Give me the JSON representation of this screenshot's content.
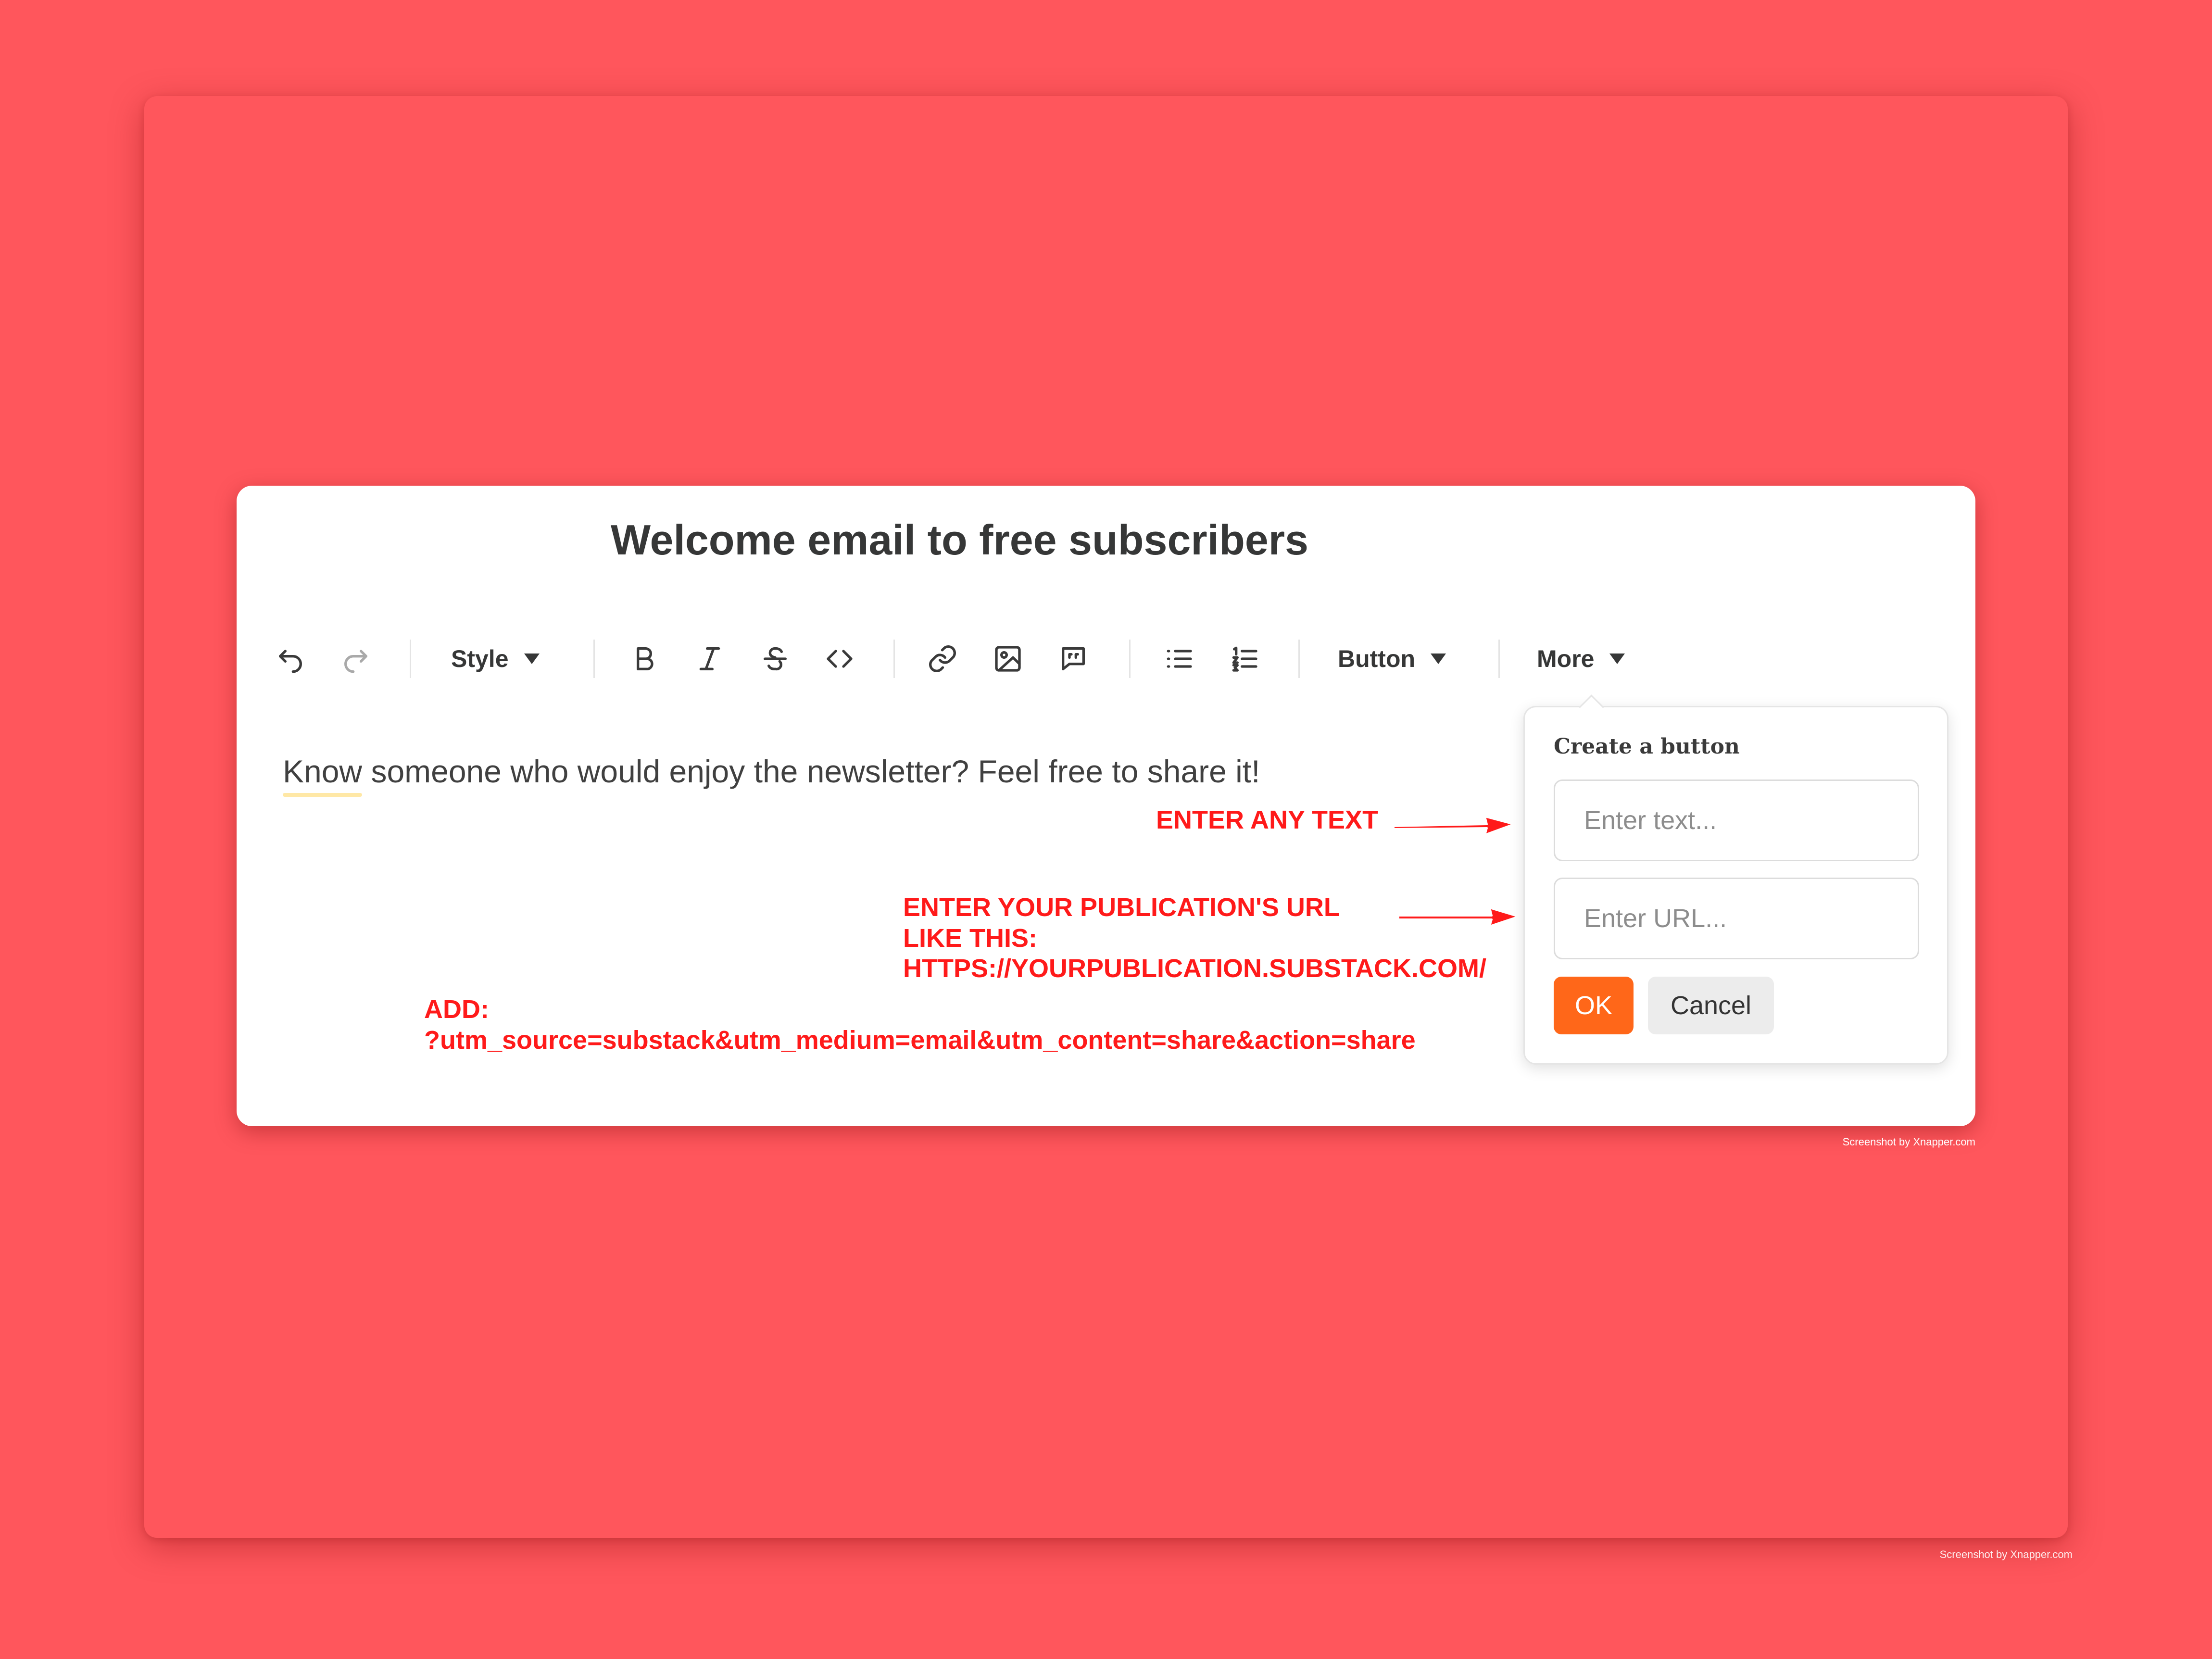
{
  "editor": {
    "title": "Welcome email to free subscribers",
    "body_first_word": "Know",
    "body_rest": " someone who would enjoy the newsletter? Feel free to share it!"
  },
  "toolbar": {
    "style_label": "Style",
    "button_label": "Button",
    "more_label": "More",
    "icons": [
      "undo-icon",
      "redo-icon",
      "bold-icon",
      "italic-icon",
      "strikethrough-icon",
      "code-icon",
      "link-icon",
      "image-icon",
      "quote-icon",
      "bullet-list-icon",
      "numbered-list-icon"
    ]
  },
  "popover": {
    "title": "Create a button",
    "text_placeholder": "Enter text...",
    "url_placeholder": "Enter URL...",
    "ok_label": "OK",
    "cancel_label": "Cancel"
  },
  "annotations": {
    "enter_text": "ENTER ANY TEXT",
    "url_line1": "ENTER YOUR PUBLICATION'S URL",
    "url_line2": "LIKE THIS:",
    "url_line3": "HTTPS://YOURPUBLICATION.SUBSTACK.COM/",
    "add_line1": "ADD:",
    "add_line2": "?utm_source=substack&utm_medium=email&utm_content=share&action=share"
  },
  "credits": {
    "inner": "Screenshot by Xnapper.com",
    "outer": "Screenshot by Xnapper.com"
  },
  "colors": {
    "background": "#ff565c",
    "accent": "#ff6719",
    "annotation": "#ff1a1a"
  }
}
